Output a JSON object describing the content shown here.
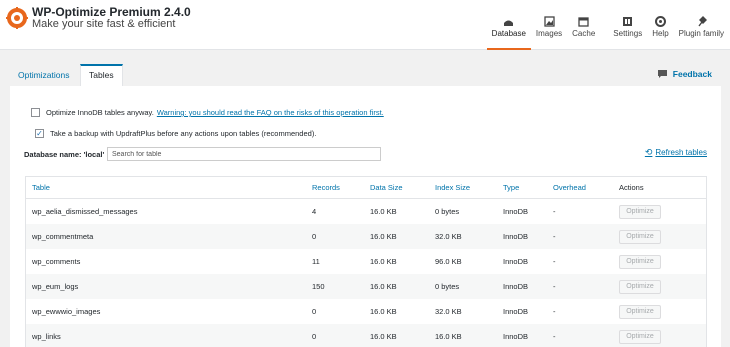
{
  "app": {
    "title": "WP-Optimize Premium 2.4.0",
    "subtitle": "Make your site fast & efficient",
    "accent_color": "#e8671c",
    "link_color": "#0073aa"
  },
  "nav": [
    {
      "label": "Database",
      "icon": "database-icon",
      "active": true
    },
    {
      "label": "Images",
      "icon": "images-icon",
      "active": false
    },
    {
      "label": "Cache",
      "icon": "cache-icon",
      "active": false
    },
    {
      "label": "Settings",
      "icon": "settings-icon",
      "active": false
    },
    {
      "label": "Help",
      "icon": "help-icon",
      "active": false
    },
    {
      "label": "Plugin family",
      "icon": "plugin-family-icon",
      "active": false
    }
  ],
  "tabs": [
    {
      "label": "Optimizations",
      "active": false
    },
    {
      "label": "Tables",
      "active": true
    }
  ],
  "feedback_label": "Feedback",
  "options": {
    "innodb": {
      "label": "Optimize InnoDB tables anyway.",
      "link": "Warning: you should read the FAQ on the risks of this operation first.",
      "checked": false
    },
    "backup": {
      "label": "Take a backup with UpdraftPlus before any actions upon tables (recommended).",
      "checked": true
    }
  },
  "database": {
    "label": "Database name: 'local'",
    "search_placeholder": "Search for table",
    "search_value": ""
  },
  "refresh_label": "Refresh tables",
  "table": {
    "columns": [
      "Table",
      "Records",
      "Data Size",
      "Index Size",
      "Type",
      "Overhead",
      "Actions"
    ],
    "rows": [
      {
        "name": "wp_aelia_dismissed_messages",
        "records": "4",
        "data_size": "16.0 KB",
        "index_size": "0 bytes",
        "type": "InnoDB",
        "overhead": "-",
        "action": "Optimize"
      },
      {
        "name": "wp_commentmeta",
        "records": "0",
        "data_size": "16.0 KB",
        "index_size": "32.0 KB",
        "type": "InnoDB",
        "overhead": "-",
        "action": "Optimize"
      },
      {
        "name": "wp_comments",
        "records": "11",
        "data_size": "16.0 KB",
        "index_size": "96.0 KB",
        "type": "InnoDB",
        "overhead": "-",
        "action": "Optimize"
      },
      {
        "name": "wp_eum_logs",
        "records": "150",
        "data_size": "16.0 KB",
        "index_size": "0 bytes",
        "type": "InnoDB",
        "overhead": "-",
        "action": "Optimize"
      },
      {
        "name": "wp_ewwwio_images",
        "records": "0",
        "data_size": "16.0 KB",
        "index_size": "32.0 KB",
        "type": "InnoDB",
        "overhead": "-",
        "action": "Optimize"
      },
      {
        "name": "wp_links",
        "records": "0",
        "data_size": "16.0 KB",
        "index_size": "16.0 KB",
        "type": "InnoDB",
        "overhead": "-",
        "action": "Optimize"
      }
    ]
  }
}
